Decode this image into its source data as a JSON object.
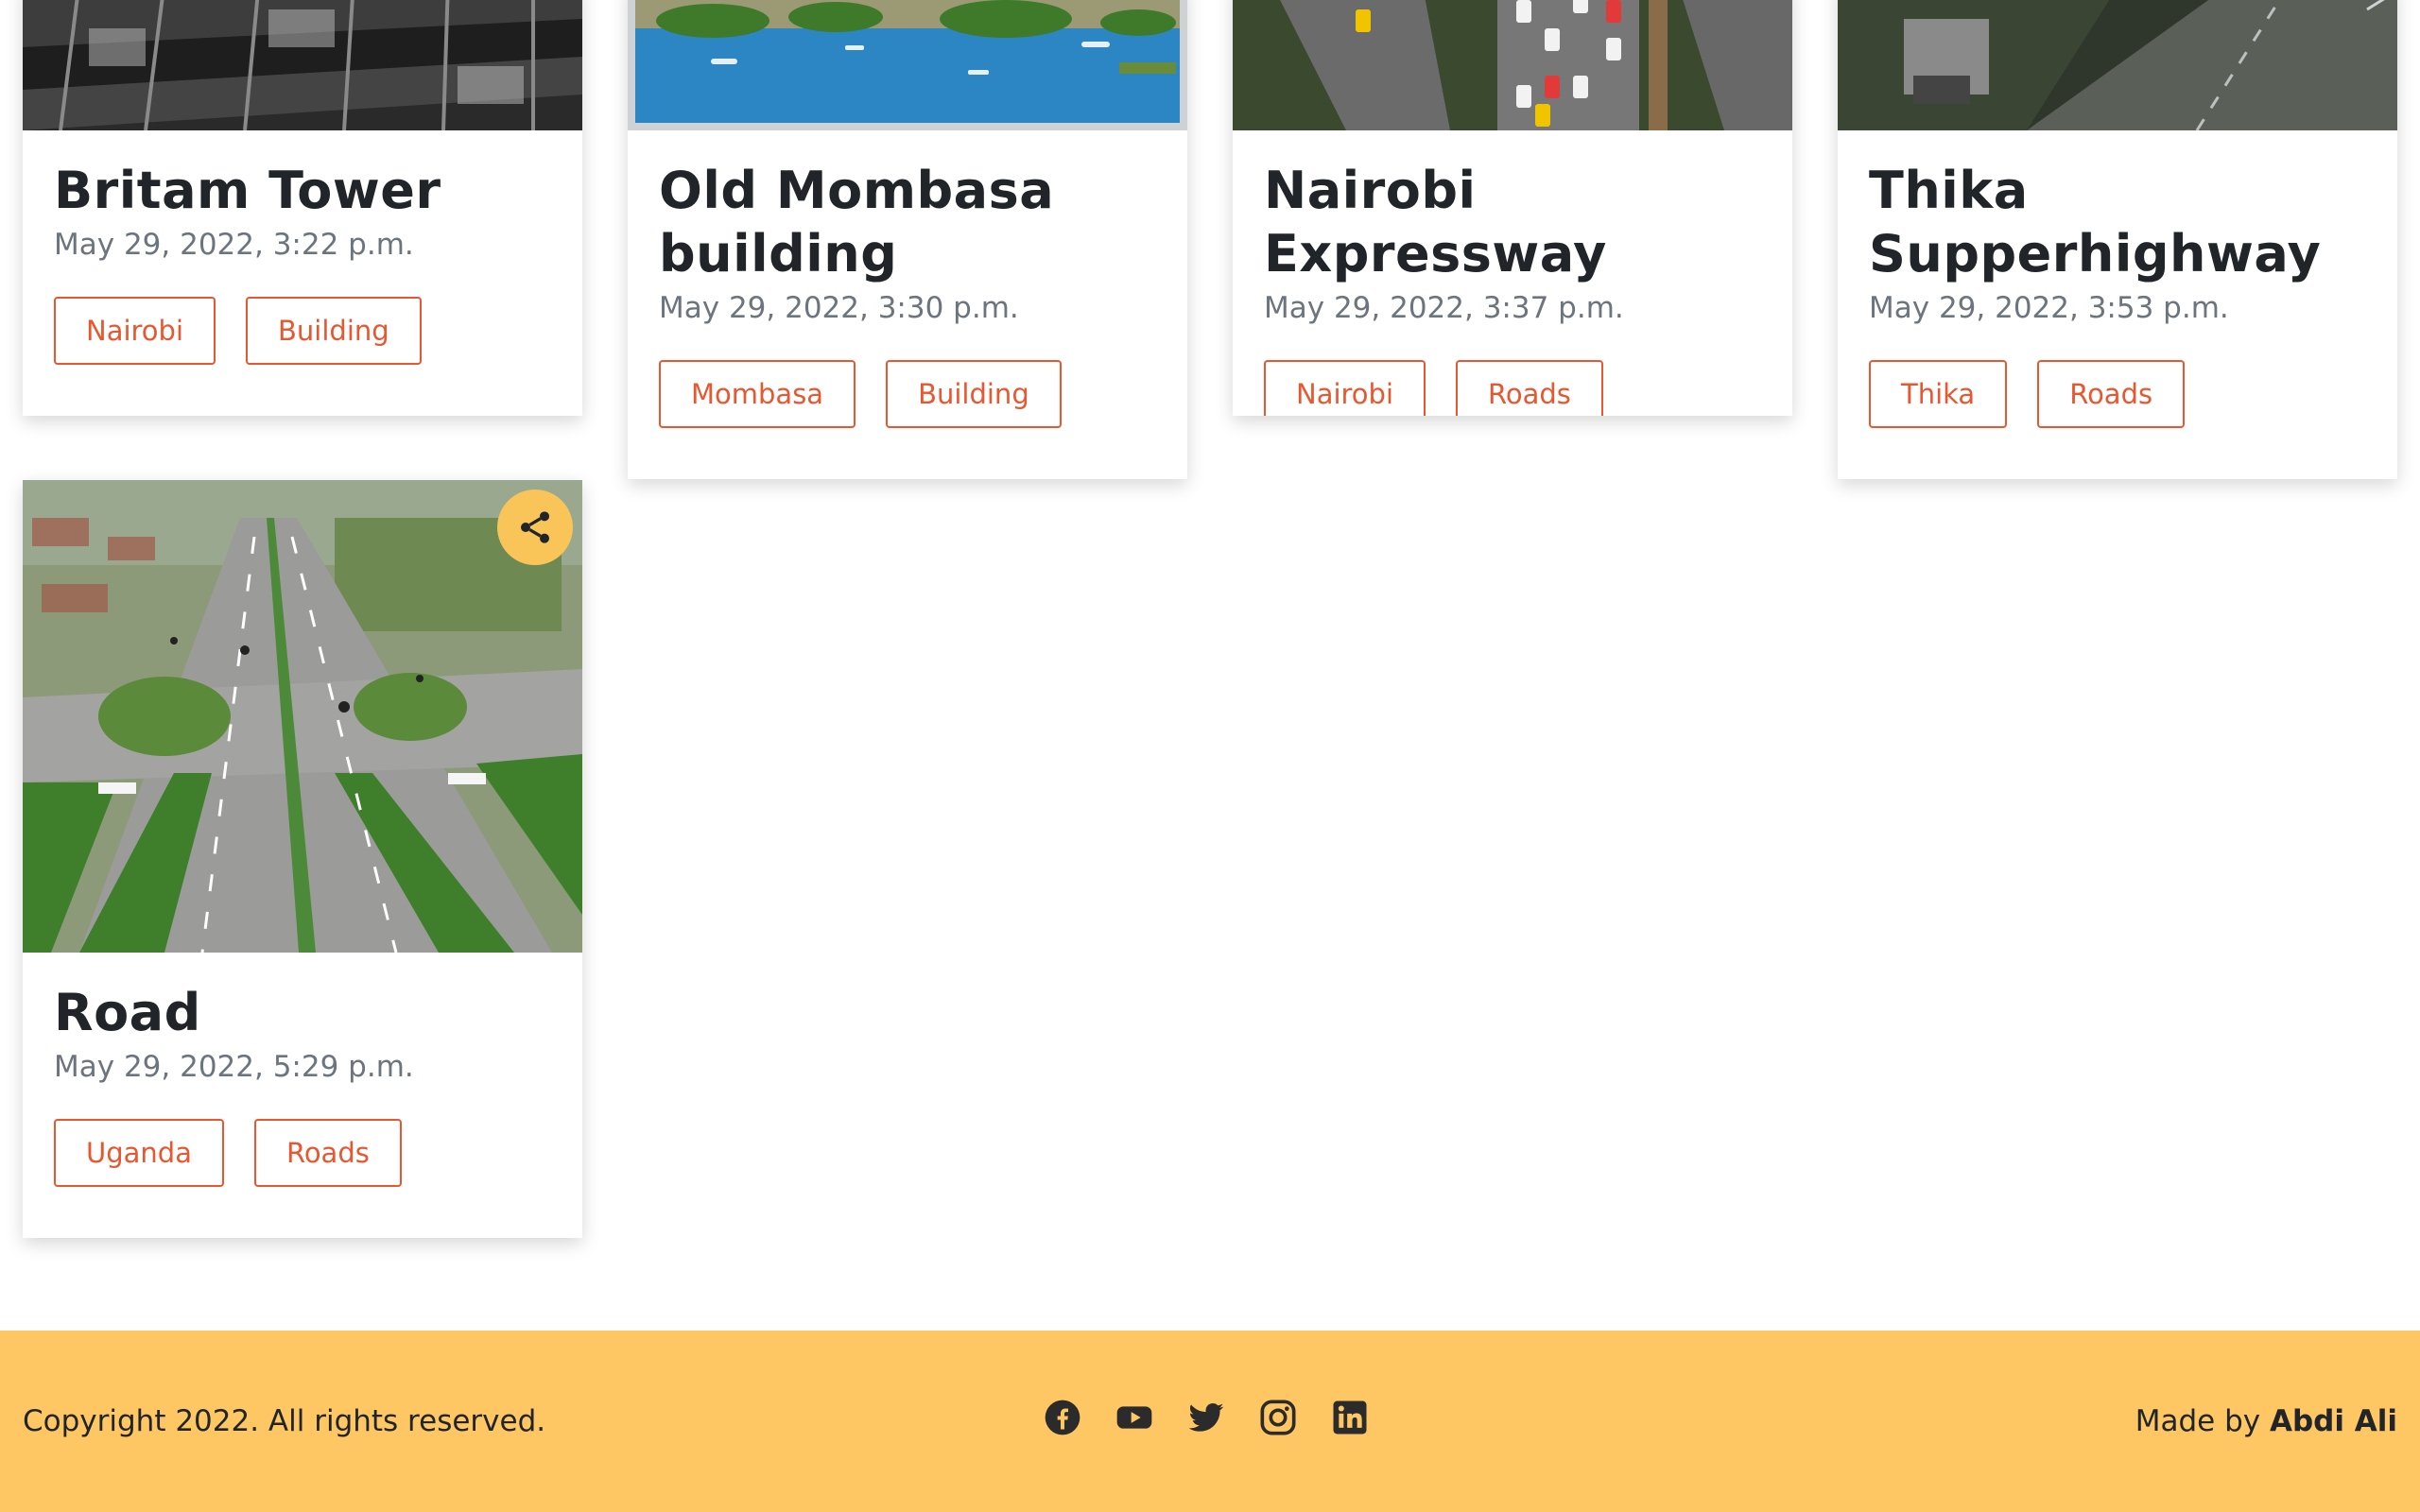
{
  "cards": [
    {
      "title": "Britam Tower",
      "date": "May 29, 2022, 3:22 p.m.",
      "tags": [
        "Nairobi",
        "Building"
      ],
      "image": "glass-building-photo"
    },
    {
      "title": "Old Mombasa building",
      "date": "May 29, 2022, 3:30 p.m.",
      "tags": [
        "Mombasa",
        "Building"
      ],
      "image": "harbour-water-photo"
    },
    {
      "title": "Nairobi Expressway",
      "date": "May 29, 2022, 3:37 p.m.",
      "tags": [
        "Nairobi",
        "Roads"
      ],
      "image": "expressway-traffic-photo"
    },
    {
      "title": "Thika Supperhighway",
      "date": "May 29, 2022, 3:53 p.m.",
      "tags": [
        "Thika",
        "Roads"
      ],
      "image": "highway-trucks-photo"
    },
    {
      "title": "Road",
      "date": "May 29, 2022, 5:29 p.m.",
      "tags": [
        "Uganda",
        "Roads"
      ],
      "image": "aerial-highway-photo",
      "share_icon": "share-icon"
    }
  ],
  "footer": {
    "copyright": "Copyright 2022. All rights reserved.",
    "made_by_prefix": "Made by",
    "author": "Abdi Ali",
    "socials": [
      "facebook-icon",
      "youtube-icon",
      "twitter-icon",
      "instagram-icon",
      "linkedin-icon"
    ]
  },
  "colors": {
    "accent": "#e8572f",
    "footer_bg": "#ffc764",
    "share_bg": "#f9c559",
    "muted_text": "#6c757d"
  }
}
